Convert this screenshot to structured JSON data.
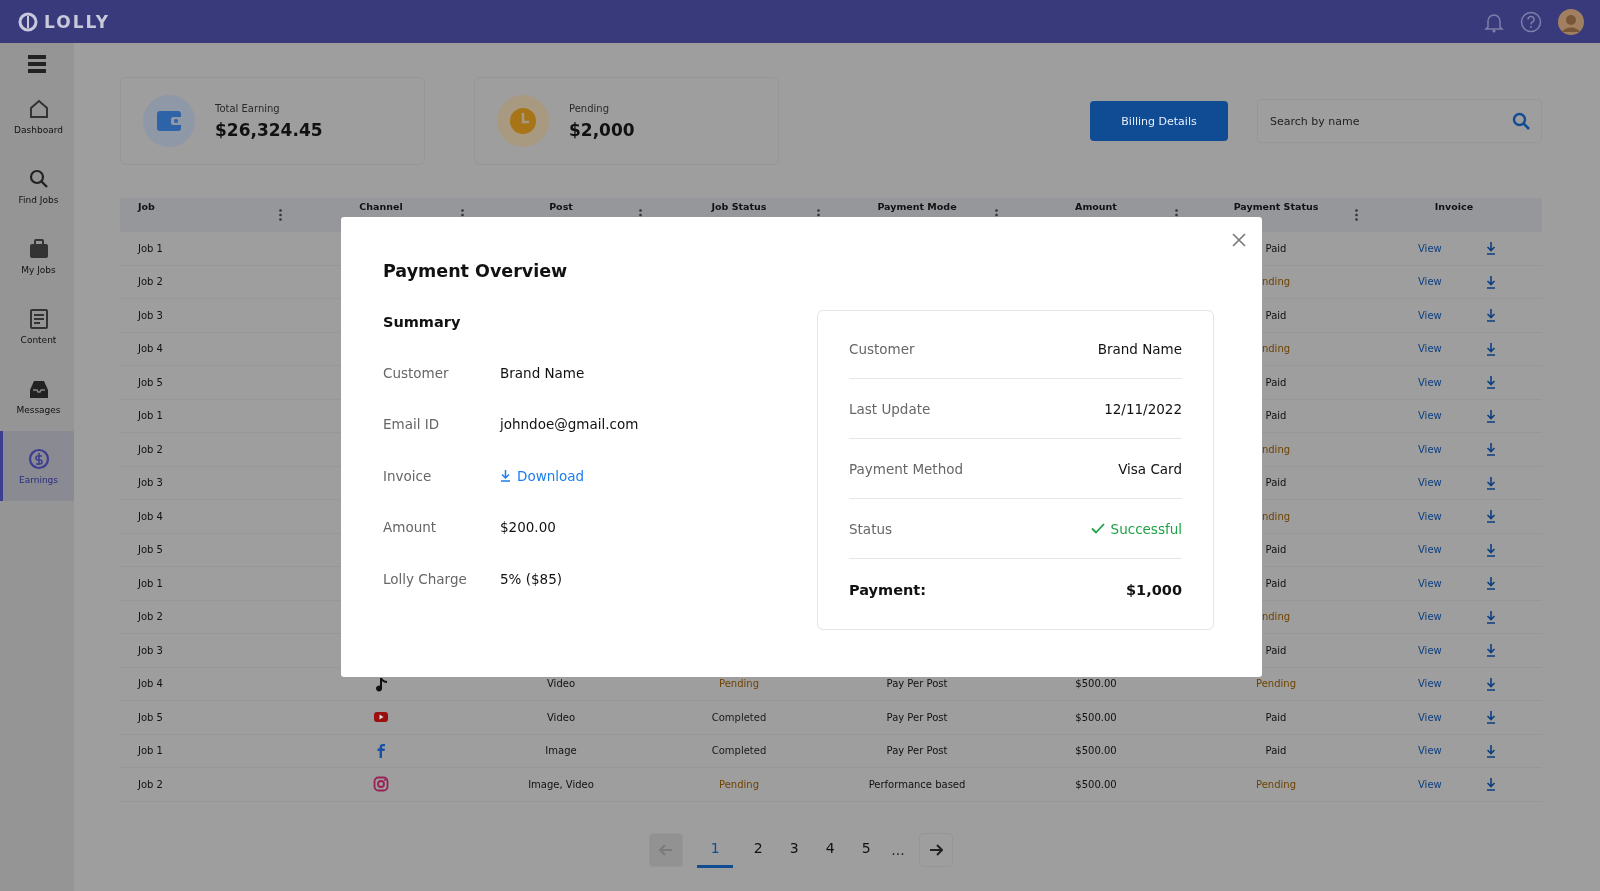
{
  "header": {
    "logo": "LOLLY"
  },
  "sidebar": {
    "items": [
      {
        "label": "Dashboard",
        "kind": "home",
        "selected": false
      },
      {
        "label": "Find Jobs",
        "kind": "search",
        "selected": false
      },
      {
        "label": "My Jobs",
        "kind": "briefcase",
        "selected": false
      },
      {
        "label": "Content",
        "kind": "document",
        "selected": false
      },
      {
        "label": "Messages",
        "kind": "inbox",
        "selected": false
      },
      {
        "label": "Earnings",
        "kind": "coin",
        "selected": true
      }
    ]
  },
  "stats": [
    {
      "label": "Total Earning",
      "value": "$26,324.45",
      "kind": "wallet"
    },
    {
      "label": "Pending",
      "value": "$2,000",
      "kind": "clock"
    }
  ],
  "billing_button": "Billing Details",
  "search": {
    "placeholder": "Search by name"
  },
  "table": {
    "columns": [
      "Job",
      "Channel",
      "Post",
      "Job Status",
      "Payment Mode",
      "Amount",
      "Payment Status",
      "Invoice"
    ],
    "rows": [
      {
        "job": "Job 1",
        "payment_status": {
          "text": "Paid",
          "kind": "paid"
        },
        "invoice_link": "View"
      },
      {
        "job": "Job 2",
        "payment_status": {
          "text": "nding",
          "kind": "pending"
        },
        "invoice_link": "View"
      },
      {
        "job": "Job 3",
        "payment_status": {
          "text": "Paid",
          "kind": "paid"
        },
        "invoice_link": "View"
      },
      {
        "job": "Job 4",
        "payment_status": {
          "text": "nding",
          "kind": "pending"
        },
        "invoice_link": "View"
      },
      {
        "job": "Job 5",
        "payment_status": {
          "text": "Paid",
          "kind": "paid"
        },
        "invoice_link": "View"
      },
      {
        "job": "Job 1",
        "payment_status": {
          "text": "Paid",
          "kind": "paid"
        },
        "invoice_link": "View"
      },
      {
        "job": "Job 2",
        "payment_status": {
          "text": "nding",
          "kind": "pending"
        },
        "invoice_link": "View"
      },
      {
        "job": "Job 3",
        "payment_status": {
          "text": "Paid",
          "kind": "paid"
        },
        "invoice_link": "View"
      },
      {
        "job": "Job 4",
        "payment_status": {
          "text": "nding",
          "kind": "pending"
        },
        "invoice_link": "View"
      },
      {
        "job": "Job 5",
        "payment_status": {
          "text": "Paid",
          "kind": "paid"
        },
        "invoice_link": "View"
      },
      {
        "job": "Job 1",
        "payment_status": {
          "text": "Paid",
          "kind": "paid"
        },
        "invoice_link": "View"
      },
      {
        "job": "Job 2",
        "payment_status": {
          "text": "nding",
          "kind": "pending"
        },
        "invoice_link": "View"
      },
      {
        "job": "Job 3",
        "payment_status": {
          "text": "Paid",
          "kind": "paid"
        },
        "invoice_link": "View"
      },
      {
        "job": "Job 4",
        "channel": {
          "kind": "note"
        },
        "post": "Video",
        "job_status": {
          "text": "Pending",
          "kind": "pending"
        },
        "payment_mode": "Pay Per Post",
        "amount": "$500.00",
        "payment_status": {
          "text": "Pending",
          "kind": "pending"
        },
        "invoice_link": "View"
      },
      {
        "job": "Job 5",
        "channel": {
          "kind": "play"
        },
        "post": "Video",
        "job_status": {
          "text": "Completed",
          "kind": "done"
        },
        "payment_mode": "Pay Per Post",
        "amount": "$500.00",
        "payment_status": {
          "text": "Paid",
          "kind": "paid"
        },
        "invoice_link": "View"
      },
      {
        "job": "Job 1",
        "channel": {
          "kind": "f"
        },
        "post": "Image",
        "job_status": {
          "text": "Completed",
          "kind": "done"
        },
        "payment_mode": "Pay Per Post",
        "amount": "$500.00",
        "payment_status": {
          "text": "Paid",
          "kind": "paid"
        },
        "invoice_link": "View"
      },
      {
        "job": "Job 2",
        "channel": {
          "kind": "camera"
        },
        "post": "Image, Video",
        "job_status": {
          "text": "Pending",
          "kind": "pending"
        },
        "payment_mode": "Performance based",
        "amount": "$500.00",
        "payment_status": {
          "text": "Pending",
          "kind": "pending"
        },
        "invoice_link": "View"
      }
    ]
  },
  "pagination": {
    "pages": [
      {
        "label": "1",
        "selected": true
      },
      {
        "label": "2",
        "selected": false
      },
      {
        "label": "3",
        "selected": false
      },
      {
        "label": "4",
        "selected": false
      },
      {
        "label": "5",
        "selected": false
      }
    ],
    "ellipsis": "...",
    "prev_disabled": true
  },
  "modal": {
    "title": "Payment Overview",
    "summary_title": "Summary",
    "summary": [
      {
        "label": "Customer",
        "value": "Brand Name",
        "kind": "text"
      },
      {
        "label": "Email ID",
        "value": "johndoe@gmail.com",
        "kind": "text"
      },
      {
        "label": "Invoice",
        "value": "Download",
        "kind": "link"
      },
      {
        "label": "Amount",
        "value": "$200.00",
        "kind": "text"
      },
      {
        "label": "Lolly Charge",
        "value": "5% ($85)",
        "kind": "text"
      }
    ],
    "details": [
      {
        "label": "Customer",
        "value": "Brand Name",
        "kind": "text"
      },
      {
        "label": "Last Update",
        "value": "12/11/2022",
        "kind": "text"
      },
      {
        "label": "Payment Method",
        "value": "Visa Card",
        "kind": "text"
      },
      {
        "label": "Status",
        "value": "Successful",
        "kind": "success"
      }
    ],
    "total": {
      "label": "Payment:",
      "value": "$1,000"
    }
  }
}
